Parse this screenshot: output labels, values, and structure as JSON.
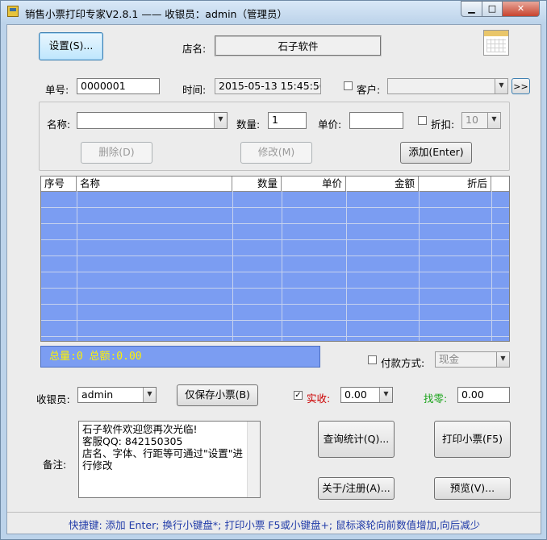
{
  "window": {
    "title": "销售小票打印专家V2.8.1 —— 收银员：admin（管理员）"
  },
  "toolbar": {
    "settings_label": "设置(S)..."
  },
  "shop": {
    "label": "店名:",
    "name": "石子软件"
  },
  "order": {
    "no_label": "单号:",
    "no_value": "0000001",
    "time_label": "时间:",
    "time_value": "2015-05-13 15:45:56",
    "customer_label": "客户:",
    "customer_value": "",
    "more_button": ">>"
  },
  "item": {
    "name_label": "名称:",
    "name_value": "",
    "qty_label": "数量:",
    "qty_value": "1",
    "price_label": "单价:",
    "price_value": "",
    "discount_label": "折扣:",
    "discount_value": "10",
    "delete_label": "删除(D)",
    "modify_label": "修改(M)",
    "add_label": "添加(Enter)"
  },
  "table": {
    "columns": [
      "序号",
      "名称",
      "数量",
      "单价",
      "金额",
      "折后"
    ],
    "rows": []
  },
  "totals": {
    "text": "总量:0  总额:0.00"
  },
  "payment": {
    "label": "付款方式:",
    "value": "现金"
  },
  "cashier": {
    "label": "收银员:",
    "value": "admin",
    "save_label": "仅保存小票(B)",
    "received_label": "实收:",
    "received_value": "0.00",
    "change_label": "找零:",
    "change_value": "0.00"
  },
  "actions": {
    "stats_label": "查询统计(Q)...",
    "print_label": "打印小票(F5)",
    "about_label": "关于/注册(A)...",
    "preview_label": "预览(V)..."
  },
  "memo": {
    "label": "备注:",
    "text": "石子软件欢迎您再次光临!\n客服QQ: 842150305\n店名、字体、行距等可通过\"设置\"进行修改"
  },
  "hint": {
    "text": "快捷键: 添加 Enter; 换行小键盘*; 打印小票 F5或小键盘+; 鼠标滚轮向前数值增加,向后减少"
  },
  "colors": {
    "grid_fill": "#7b9df2",
    "totals_text": "#fff200",
    "received_label": "#cc0000",
    "change_label": "#1aa31a",
    "hint_text": "#1f3aa8"
  }
}
